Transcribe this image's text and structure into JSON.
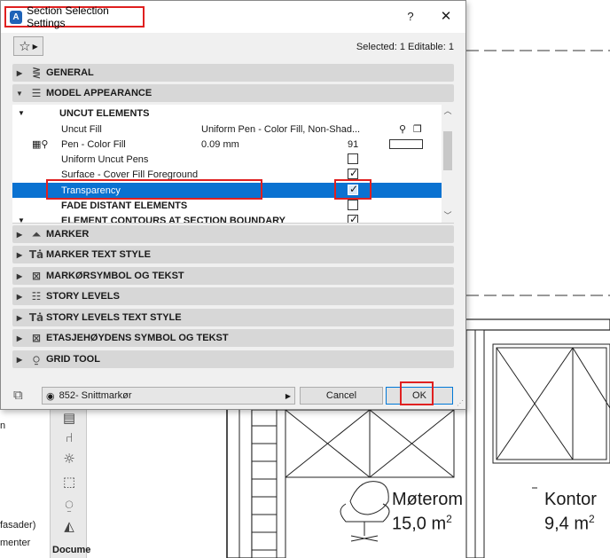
{
  "dialog": {
    "title": "Section Selection Settings",
    "help_label": "?",
    "close_label": "✕",
    "selected_info": "Selected: 1 Editable: 1",
    "sections_top": [
      {
        "label": "GENERAL",
        "arrow": "▶",
        "icon": "general-icon"
      },
      {
        "label": "MODEL APPEARANCE",
        "arrow": "▼",
        "icon": "model-appearance-icon"
      }
    ],
    "rows": [
      {
        "name": "UNCUT ELEMENTS",
        "value": "",
        "extra": "",
        "type": "group"
      },
      {
        "name": "Uncut Fill",
        "value": "Uniform Pen - Color Fill, Non-Shad...",
        "extra": "",
        "type": "value"
      },
      {
        "name": "Pen - Color Fill",
        "value": "0.09 mm",
        "extra": "91",
        "type": "pen"
      },
      {
        "name": "Uniform Uncut Pens",
        "value": "",
        "extra": "",
        "type": "checkbox",
        "checked": false
      },
      {
        "name": "Surface - Cover Fill Foreground",
        "value": "",
        "extra": "",
        "type": "checkbox",
        "checked": true
      },
      {
        "name": "Transparency",
        "value": "",
        "extra": "",
        "type": "checkbox",
        "checked": true,
        "selected": true
      },
      {
        "name": "FADE DISTANT ELEMENTS",
        "value": "",
        "extra": "",
        "type": "checkbox-group",
        "checked": false
      },
      {
        "name": "ELEMENT CONTOURS AT SECTION BOUNDARY",
        "value": "",
        "extra": "",
        "type": "checkbox-group",
        "checked": true
      }
    ],
    "sections_bottom": [
      {
        "label": "MARKER",
        "icon": "marker-icon"
      },
      {
        "label": "MARKER TEXT STYLE",
        "icon": "text-style-icon"
      },
      {
        "label": "MARKØRSYMBOL OG TEKST",
        "icon": "symbol-text-icon"
      },
      {
        "label": "STORY LEVELS",
        "icon": "story-levels-icon"
      },
      {
        "label": "STORY LEVELS TEXT STYLE",
        "icon": "text-style-icon"
      },
      {
        "label": "ETASJEHØYDENS SYMBOL OG TEKST",
        "icon": "symbol-text-icon"
      },
      {
        "label": "GRID TOOL",
        "icon": "grid-tool-icon"
      }
    ],
    "layer": "852- Snittmarkør",
    "cancel_label": "Cancel",
    "ok_label": "OK"
  },
  "background": {
    "rooms": [
      {
        "name": "Møterom",
        "area": "15,0 m",
        "unit_sup": "2"
      },
      {
        "name": "Kontor",
        "area": "9,4 m",
        "unit_sup": "2"
      }
    ],
    "side_texts": [
      "n",
      "fasader)",
      "menter"
    ],
    "toolbox_label": "Docume"
  },
  "colors": {
    "selection": "#0a72d1",
    "highlight_box": "#e02020",
    "section_bg": "#d7d7d7",
    "dialog_bg": "#f0f0f0"
  }
}
